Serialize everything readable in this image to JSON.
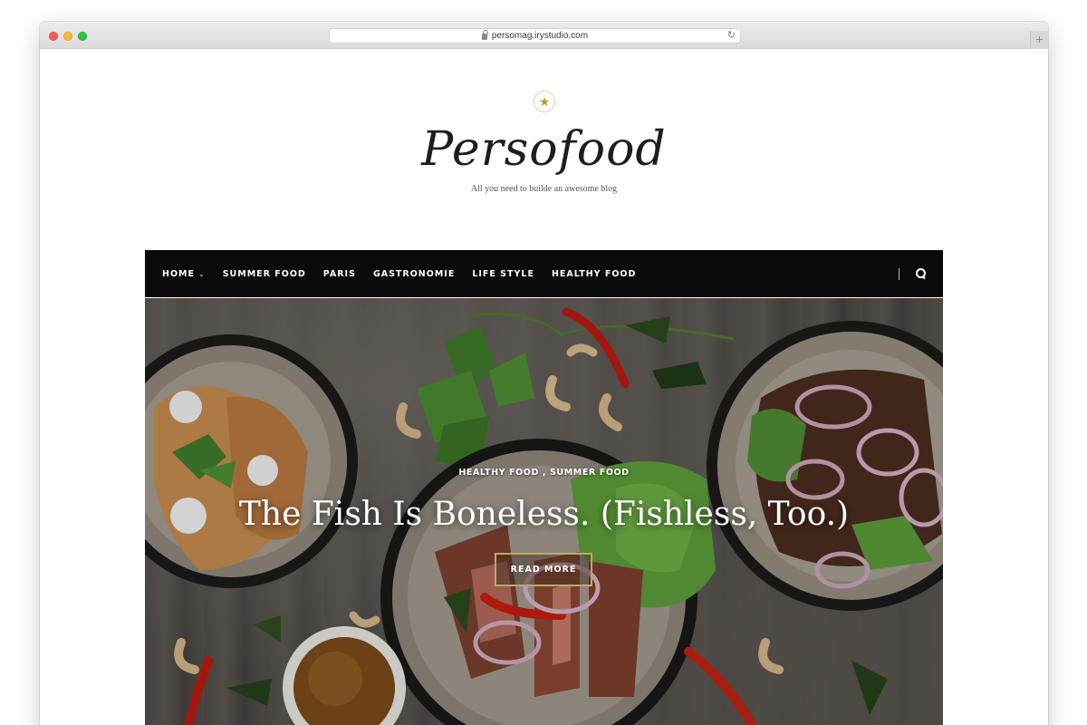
{
  "browser": {
    "url": "persomag.irystudio.com",
    "new_tab_label": "+",
    "reload_glyph": "↻"
  },
  "site": {
    "star_glyph": "★",
    "logo": "Persofood",
    "tagline": "All you need to builde an awesome blog"
  },
  "nav": {
    "items": [
      {
        "label": "HOME",
        "has_dropdown": true
      },
      {
        "label": "SUMMER FOOD"
      },
      {
        "label": "PARIS"
      },
      {
        "label": "GASTRONOMIE"
      },
      {
        "label": "LIFE STYLE"
      },
      {
        "label": "HEALTHY FOOD"
      }
    ],
    "dropdown_glyph": "⌄"
  },
  "hero": {
    "categories": "HEALTHY FOOD , SUMMER FOOD",
    "title": "The Fish Is Boneless. (Fishless, Too.)",
    "button_label": "READ MORE"
  },
  "colors": {
    "nav_bg": "#0a0a0a",
    "accent_gold": "#c3a664",
    "star": "#b7a11a"
  }
}
